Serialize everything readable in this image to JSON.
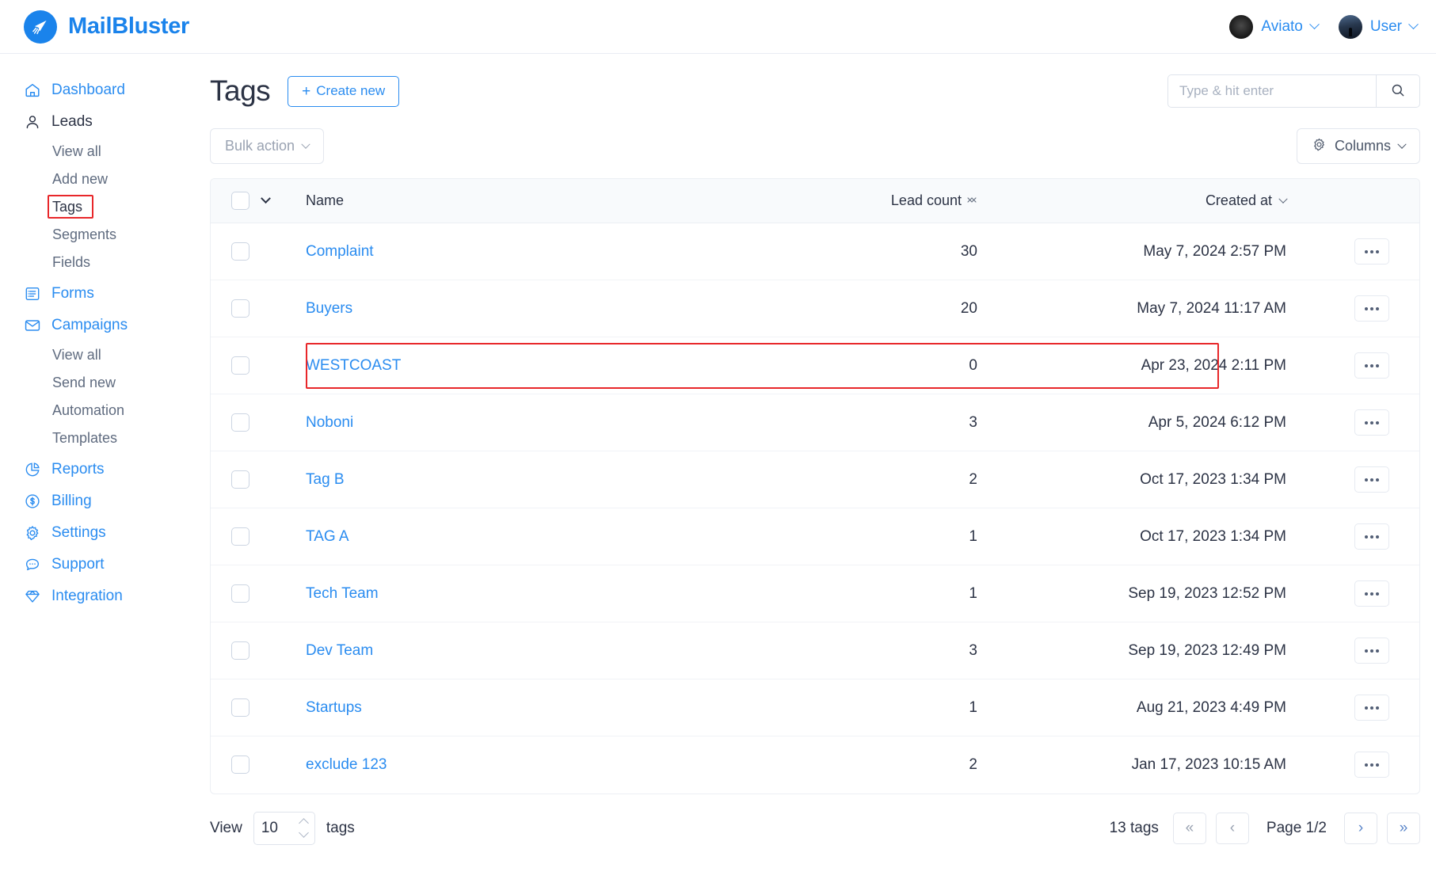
{
  "brand": {
    "name": "MailBluster",
    "logo_icon": "paper-plane-cursor-icon",
    "accent": "#1a83eb"
  },
  "topbar": {
    "org": {
      "label": "Aviato",
      "avatar_icon": "org-avatar"
    },
    "user": {
      "label": "User",
      "avatar_icon": "user-avatar"
    }
  },
  "sidebar": {
    "items": [
      {
        "label": "Dashboard",
        "icon": "home-icon"
      },
      {
        "label": "Leads",
        "icon": "person-icon"
      },
      {
        "label": "View all",
        "icon": ""
      },
      {
        "label": "Add new",
        "icon": ""
      },
      {
        "label": "Tags",
        "icon": ""
      },
      {
        "label": "Segments",
        "icon": ""
      },
      {
        "label": "Fields",
        "icon": ""
      },
      {
        "label": "Forms",
        "icon": "form-list-icon"
      },
      {
        "label": "Campaigns",
        "icon": "envelope-icon"
      },
      {
        "label": "View all",
        "icon": ""
      },
      {
        "label": "Send new",
        "icon": ""
      },
      {
        "label": "Automation",
        "icon": ""
      },
      {
        "label": "Templates",
        "icon": ""
      },
      {
        "label": "Reports",
        "icon": "pie-chart-icon"
      },
      {
        "label": "Billing",
        "icon": "dollar-circle-icon"
      },
      {
        "label": "Settings",
        "icon": "gear-icon"
      },
      {
        "label": "Support",
        "icon": "chat-bubble-icon"
      },
      {
        "label": "Integration",
        "icon": "diamond-icon"
      }
    ]
  },
  "page": {
    "title": "Tags",
    "create_label": "Create new",
    "create_plus": "+",
    "highlight_color": "#e8272a"
  },
  "search": {
    "placeholder": "Type & hit enter",
    "value": "",
    "icon": "search-icon"
  },
  "toolbar": {
    "bulk_label": "Bulk action",
    "columns_label": "Columns",
    "columns_icon": "gear-icon"
  },
  "table": {
    "columns": [
      "Name",
      "Lead count",
      "Created at"
    ],
    "rows": [
      {
        "name": "Complaint",
        "lead_count": "30",
        "created_at": "May 7, 2024 2:57 PM",
        "highlighted": false
      },
      {
        "name": "Buyers",
        "lead_count": "20",
        "created_at": "May 7, 2024 11:17 AM",
        "highlighted": false
      },
      {
        "name": "WESTCOAST",
        "lead_count": "0",
        "created_at": "Apr 23, 2024 2:11 PM",
        "highlighted": true
      },
      {
        "name": "Noboni",
        "lead_count": "3",
        "created_at": "Apr 5, 2024 6:12 PM",
        "highlighted": false
      },
      {
        "name": "Tag B",
        "lead_count": "2",
        "created_at": "Oct 17, 2023 1:34 PM",
        "highlighted": false
      },
      {
        "name": "TAG A",
        "lead_count": "1",
        "created_at": "Oct 17, 2023 1:34 PM",
        "highlighted": false
      },
      {
        "name": "Tech Team",
        "lead_count": "1",
        "created_at": "Sep 19, 2023 12:52 PM",
        "highlighted": false
      },
      {
        "name": "Dev Team",
        "lead_count": "3",
        "created_at": "Sep 19, 2023 12:49 PM",
        "highlighted": false
      },
      {
        "name": "Startups",
        "lead_count": "1",
        "created_at": "Aug 21, 2023 4:49 PM",
        "highlighted": false
      },
      {
        "name": "exclude 123",
        "lead_count": "2",
        "created_at": "Jan 17, 2023 10:15 AM",
        "highlighted": false
      }
    ]
  },
  "footer": {
    "view_label": "View",
    "page_size": "10",
    "unit_label": "tags",
    "total_label": "13 tags",
    "page_label": "Page 1/2",
    "first_label": "«",
    "prev_label": "‹",
    "next_label": "›",
    "last_label": "»"
  }
}
